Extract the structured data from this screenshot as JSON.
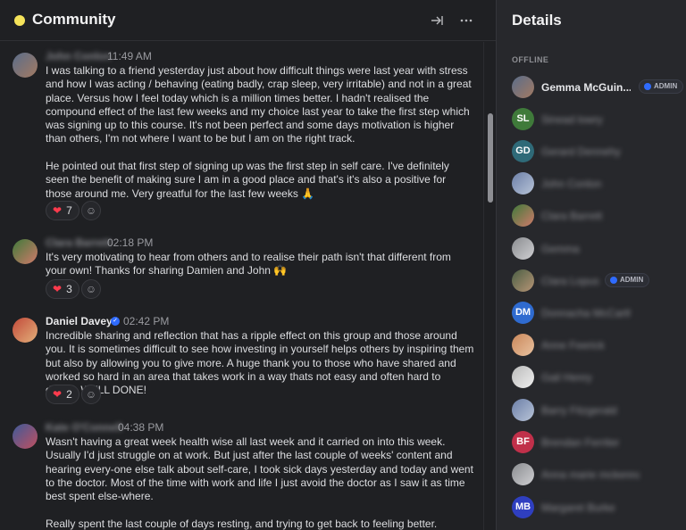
{
  "header": {
    "title": "Community",
    "status_color": "#f5e35a",
    "collapse_icon": "sidebar-collapse-icon",
    "more_icon": "more-horizontal-icon"
  },
  "messages": [
    {
      "author": "John Conlon",
      "time": "11:49 AM",
      "body": "I was talking to a friend yesterday just about how difficult things were last year with stress and how I was acting / behaving (eating badly, crap sleep, very irritable) and not in a great place. Versus how I feel today which is a million times better. I hadn't realised the compound effect of the last few weeks and my choice last year to take the first step which was signing up to this course. It's not been perfect and some days motivation is higher than others, I'm not where I want to be but I am on the right track.\n\nHe pointed out that first step of signing up was the first step in self care. I've definitely seen the benefit of making sure I am in a good place and that's it's also a positive for those around me. Very greatful for the last few weeks 🙏",
      "reaction_count": "7"
    },
    {
      "author": "Clara Barrett",
      "time": "02:18 PM",
      "body": "It's very motivating to hear from others and to realise their path isn't that different from your own! Thanks for sharing Damien and John 🙌",
      "reaction_count": "3"
    },
    {
      "author": "Daniel Davey",
      "time": "02:42 PM",
      "body": "Incredible sharing and reflection that has a ripple effect on this group and those around you. It is sometimes difficult to see how investing in yourself helps others by inspiring them but also by allowing you to give more. A huge thank you to those who have shared and worked so hard in an area that takes work in a way thats not easy and often hard to define. WELL DONE!",
      "reaction_count": "2"
    },
    {
      "author": "Kate O'Connell",
      "time": "04:38 PM",
      "body": " Wasn't having a great week health wise all last week and it carried on into this week. Usually I'd just struggle on at work. But just after the last couple of weeks' content and hearing every-one else talk about self-care, I took sick days yesterday and today and went to the doctor. Most of the time with work and life I just avoid the doctor as I saw it as time best spent else-where.\n\nReally spent the last couple of days resting, and trying to get back to feeling better."
    }
  ],
  "details": {
    "title": "Details",
    "section_label": "OFFLINE",
    "admin_label": "ADMIN",
    "members": [
      {
        "name": "Gemma McGuin...",
        "initials": ""
      },
      {
        "name": "Sinead lowry",
        "initials": "SL",
        "color": "#3f7a3a"
      },
      {
        "name": "Gerard Dennehy",
        "initials": "GD",
        "color": "#2f6a78"
      },
      {
        "name": "John Conlon",
        "initials": ""
      },
      {
        "name": "Clara Barrett",
        "initials": ""
      },
      {
        "name": "Gemma",
        "initials": ""
      },
      {
        "name": "Clara Lopus",
        "initials": ""
      },
      {
        "name": "Donnacha McCarthy",
        "initials": "DM",
        "color": "#2f6bd0"
      },
      {
        "name": "Anne Feerick",
        "initials": ""
      },
      {
        "name": "Gail Henry",
        "initials": ""
      },
      {
        "name": "Barry Fitzgerald",
        "initials": ""
      },
      {
        "name": "Brendan Ferriter",
        "initials": "BF",
        "color": "#c0304a"
      },
      {
        "name": "Anna marie mckenna",
        "initials": ""
      },
      {
        "name": "Margaret Burke",
        "initials": "MB",
        "color": "#2f3fc0"
      }
    ]
  }
}
